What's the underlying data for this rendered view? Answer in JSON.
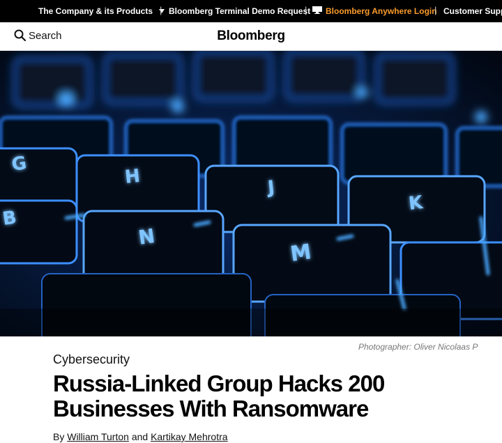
{
  "topbar": {
    "company_label": "The Company & its Products",
    "separator": "|",
    "demo_label": "Bloomberg Terminal Demo Request",
    "anywhere_label": "Bloomberg Anywhere Login",
    "support_label": "Customer Support",
    "accent_color": "#fa9b2b"
  },
  "header": {
    "search_label": "Search",
    "logo": "Bloomberg"
  },
  "hero": {
    "keys": [
      "G",
      "H",
      "J",
      "K",
      "B",
      "N",
      "M"
    ],
    "caption": "Photographer: Oliver Nicolaas P"
  },
  "article": {
    "section": "Cybersecurity",
    "headline_line1": "Russia-Linked Group Hacks 200",
    "headline_line2": "Businesses With Ransomware",
    "by": "By",
    "author1": "William Turton",
    "and": "and",
    "author2": "Kartikay Mehrotra"
  }
}
